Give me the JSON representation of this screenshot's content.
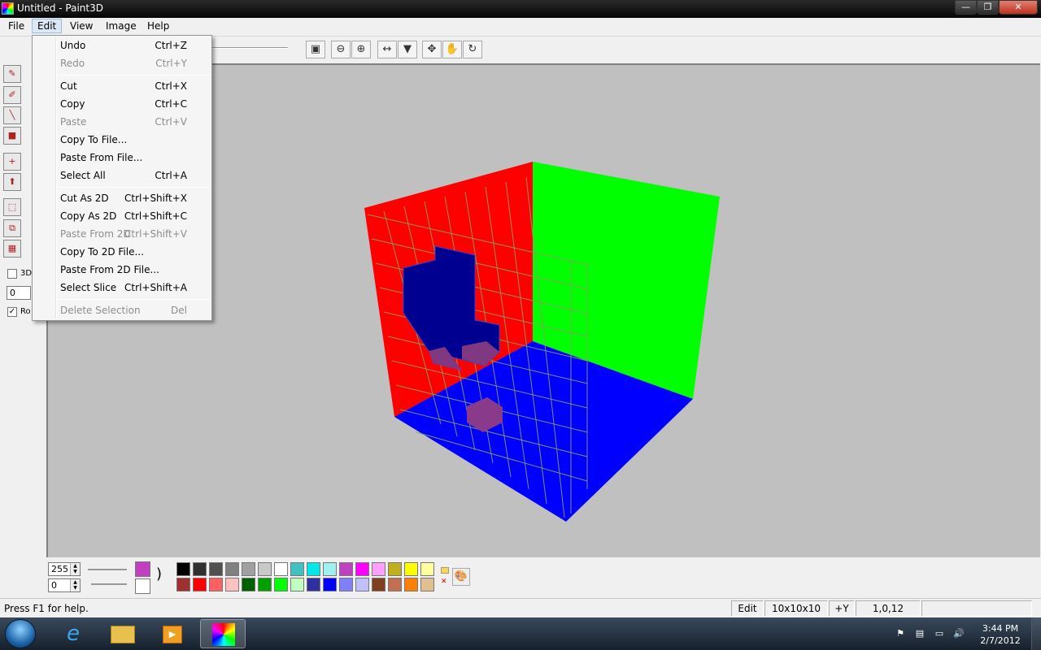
{
  "window": {
    "title": "Untitled - Paint3D",
    "min_label": "—",
    "max_label": "❐",
    "close_label": "✕"
  },
  "menubar": {
    "file": "File",
    "edit": "Edit",
    "view": "View",
    "image": "Image",
    "help": "Help"
  },
  "edit_menu": {
    "undo": {
      "label": "Undo",
      "shortcut": "Ctrl+Z"
    },
    "redo": {
      "label": "Redo",
      "shortcut": "Ctrl+Y"
    },
    "cut": {
      "label": "Cut",
      "shortcut": "Ctrl+X"
    },
    "copy": {
      "label": "Copy",
      "shortcut": "Ctrl+C"
    },
    "paste": {
      "label": "Paste",
      "shortcut": "Ctrl+V"
    },
    "copy_to_file": {
      "label": "Copy To File...",
      "shortcut": ""
    },
    "paste_from_file": {
      "label": "Paste From File...",
      "shortcut": ""
    },
    "select_all": {
      "label": "Select All",
      "shortcut": "Ctrl+A"
    },
    "cut_as_2d": {
      "label": "Cut As 2D",
      "shortcut": "Ctrl+Shift+X"
    },
    "copy_as_2d": {
      "label": "Copy As 2D",
      "shortcut": "Ctrl+Shift+C"
    },
    "paste_from_2d": {
      "label": "Paste From 2D",
      "shortcut": "Ctrl+Shift+V"
    },
    "copy_to_2d_file": {
      "label": "Copy To 2D File...",
      "shortcut": ""
    },
    "paste_from_2d_file": {
      "label": "Paste From 2D File...",
      "shortcut": ""
    },
    "select_slice": {
      "label": "Select Slice",
      "shortcut": "Ctrl+Shift+A"
    },
    "delete_selection": {
      "label": "Delete Selection",
      "shortcut": "Del"
    }
  },
  "left_panel": {
    "check_3d_label": "3D",
    "spin_value": "0",
    "check_r_label": "Ro"
  },
  "bottom": {
    "alpha_value": "255",
    "second_value": "0"
  },
  "palette": {
    "primary_color": "#c040c0",
    "secondary_color": "#ffffff",
    "row1": [
      "#000000",
      "#303030",
      "#505050",
      "#808080",
      "#a0a0a0",
      "#c8c8c8",
      "#ffffff",
      "#40c0c0",
      "#00e8e8",
      "#a0f0f0",
      "#c040c0",
      "#ff00ff",
      "#ffa0ff",
      "#c0b020",
      "#ffff00",
      "#ffffa0"
    ],
    "row2": [
      "#a03030",
      "#ff0000",
      "#ff6060",
      "#ffc0c0",
      "#006000",
      "#00a000",
      "#00ff00",
      "#c0ffc0",
      "#3030a0",
      "#0000ff",
      "#8080ff",
      "#c0c0ff",
      "#804020",
      "#c07050",
      "#ff8000",
      "#e0c090"
    ]
  },
  "status": {
    "help_text": "Press F1 for help.",
    "mode": "Edit",
    "size": "10x10x10",
    "axis": "+Y",
    "coords": "1,0,12"
  },
  "taskbar": {
    "time": "3:44 PM",
    "date": "2/7/2012"
  }
}
